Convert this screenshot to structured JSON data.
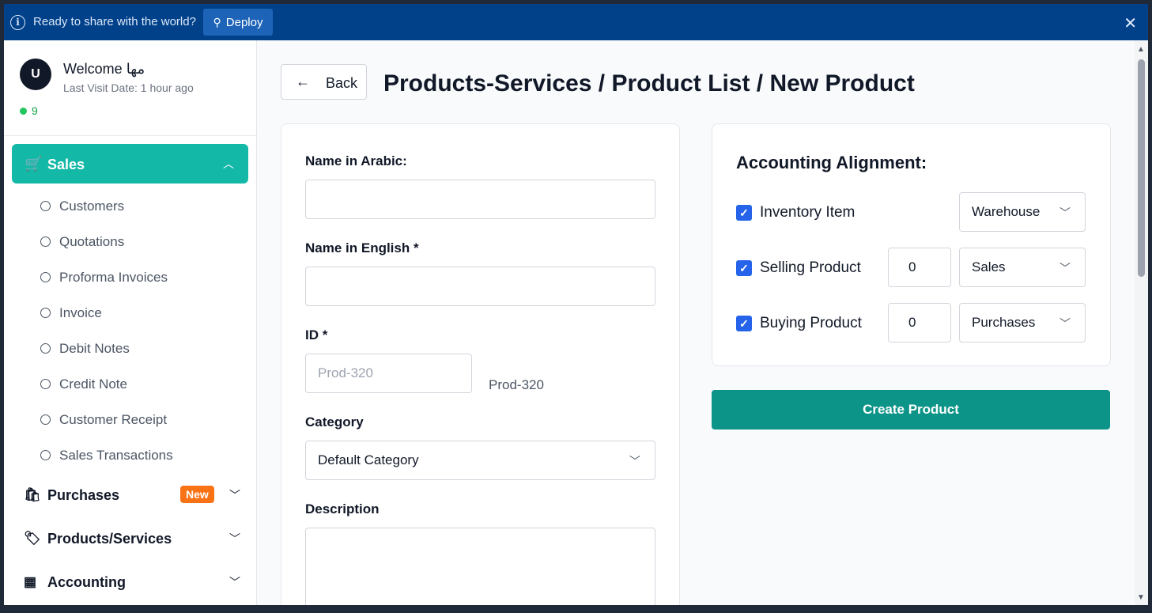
{
  "banner": {
    "message": "Ready to share with the world?",
    "deploy_label": "Deploy",
    "info_icon": "info-icon",
    "close_icon": "close-icon"
  },
  "user": {
    "avatar_letter": "U",
    "welcome": "Welcome مها",
    "last_visit": "Last Visit Date: 1 hour ago",
    "online_count": "9"
  },
  "sidebar": {
    "sales_label": "Sales",
    "sales_items": [
      "Customers",
      "Quotations",
      "Proforma Invoices",
      "Invoice",
      "Debit Notes",
      "Credit Note",
      "Customer Receipt",
      "Sales Transactions"
    ],
    "purchases_label": "Purchases",
    "purchases_badge": "New",
    "products_label": "Products/Services",
    "accounting_label": "Accounting"
  },
  "header": {
    "back_label": "Back",
    "title": "Products-Services / Product List / New Product"
  },
  "form": {
    "name_ar_label": "Name in Arabic:",
    "name_ar_value": "",
    "name_en_label": "Name in English *",
    "name_en_value": "",
    "id_label": "ID *",
    "id_placeholder": "Prod-320",
    "id_value": "Prod-320",
    "category_label": "Category",
    "category_value": "Default Category",
    "description_label": "Description"
  },
  "accounting": {
    "title": "Accounting Alignment:",
    "rows": [
      {
        "label": "Inventory Item",
        "checked": true,
        "select": "Warehouse"
      },
      {
        "label": "Selling Product",
        "checked": true,
        "number": "0",
        "select": "Sales"
      },
      {
        "label": "Buying Product",
        "checked": true,
        "number": "0",
        "select": "Purchases"
      }
    ]
  },
  "create_label": "Create Product",
  "colors": {
    "banner": "#00418a",
    "sales_active": "#14b8a6",
    "create_button": "#0d9488",
    "checkbox": "#2563eb",
    "badge_new": "#f97316"
  }
}
